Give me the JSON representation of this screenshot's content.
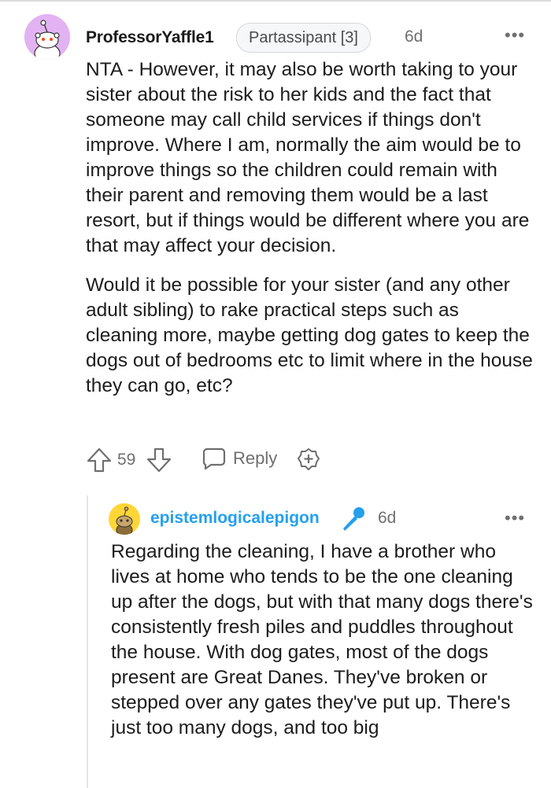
{
  "comment": {
    "author": "ProfessorYaffle1",
    "flair": "Partassipant [3]",
    "time": "6d",
    "more_label": "•••",
    "paragraphs": [
      "NTA - However, it may also be worth taking to your sister about the risk to her kids and the fact that someone may call child services if things don't improve. Where I am, normally the aim would be to improve things so the children could remain with their parent and removing them would be a last resort, but if things would be different where you are that may affect your decision.",
      "Would it be possible for your sister (and any other adult sibling) to rake practical steps such as cleaning more, maybe getting dog gates to keep the dogs out of bedrooms etc to limit where in the house they can go, etc?"
    ],
    "score": "59",
    "reply_label": "Reply",
    "avatar_color": "#e3b2f2"
  },
  "reply": {
    "author": "epistemlogicalepigon",
    "time": "6d",
    "more_label": "•••",
    "text": "Regarding the cleaning, I have a brother who lives at home who tends to be the one cleaning up after the dogs, but with that many dogs there's consistently fresh piles and puddles throughout the house. With dog gates, most of the dogs present are Great Danes. They've broken or stepped over any gates they've put up. There's just too many dogs, and too big",
    "author_color": "#24a0ed",
    "avatar_color": "#ffd635"
  },
  "icons": {
    "upvote": "arrow-up-icon",
    "downvote": "arrow-down-icon",
    "reply": "speech-bubble-icon",
    "award": "plus-award-icon",
    "mic": "microphone-icon",
    "more": "ellipsis-icon"
  }
}
